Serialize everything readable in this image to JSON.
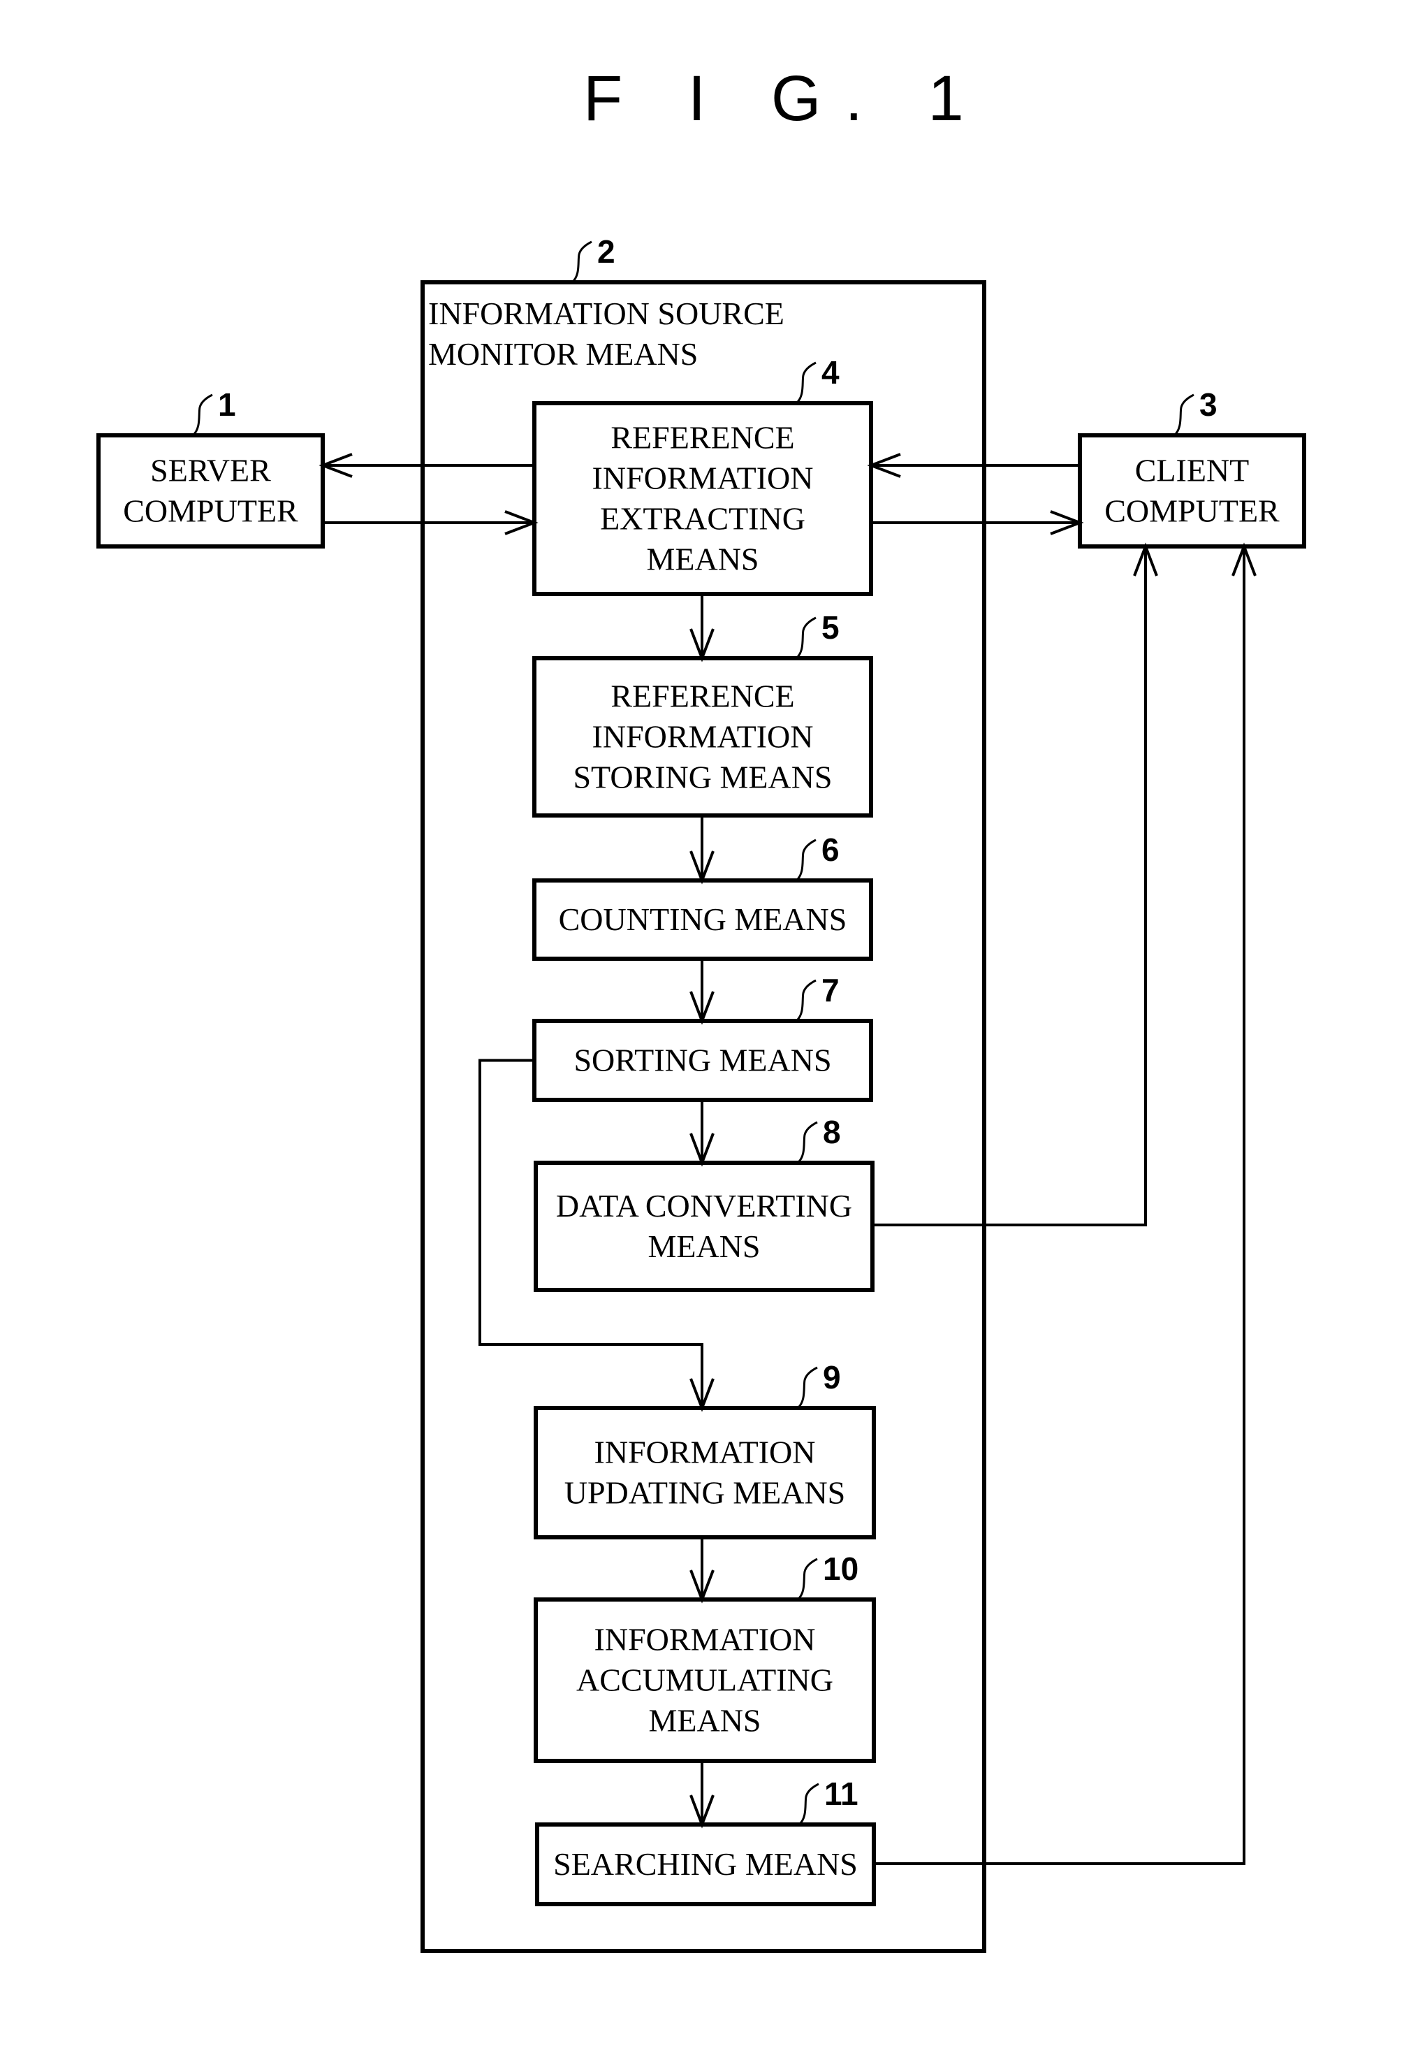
{
  "figure": {
    "title": "F I G. 1"
  },
  "nodes": [
    {
      "id": "server",
      "ref": "1",
      "lines": [
        "SERVER",
        "COMPUTER"
      ]
    },
    {
      "id": "monitor",
      "ref": "2",
      "lines": [
        "INFORMATION SOURCE",
        "MONITOR MEANS"
      ]
    },
    {
      "id": "client",
      "ref": "3",
      "lines": [
        "CLIENT",
        "COMPUTER"
      ]
    },
    {
      "id": "extracting",
      "ref": "4",
      "lines": [
        "REFERENCE",
        "INFORMATION",
        "EXTRACTING",
        "MEANS"
      ]
    },
    {
      "id": "storing",
      "ref": "5",
      "lines": [
        "REFERENCE",
        "INFORMATION",
        "STORING MEANS"
      ]
    },
    {
      "id": "counting",
      "ref": "6",
      "lines": [
        "COUNTING MEANS"
      ]
    },
    {
      "id": "sorting",
      "ref": "7",
      "lines": [
        "SORTING MEANS"
      ]
    },
    {
      "id": "converting",
      "ref": "8",
      "lines": [
        "DATA CONVERTING",
        "MEANS"
      ]
    },
    {
      "id": "updating",
      "ref": "9",
      "lines": [
        "INFORMATION",
        "UPDATING MEANS"
      ]
    },
    {
      "id": "accumulating",
      "ref": "10",
      "lines": [
        "INFORMATION",
        "ACCUMULATING",
        "MEANS"
      ]
    },
    {
      "id": "searching",
      "ref": "11",
      "lines": [
        "SEARCHING MEANS"
      ]
    }
  ],
  "edges": [
    {
      "from": "extracting",
      "to": "server"
    },
    {
      "from": "server",
      "to": "extracting"
    },
    {
      "from": "client",
      "to": "extracting"
    },
    {
      "from": "extracting",
      "to": "client"
    },
    {
      "from": "extracting",
      "to": "storing"
    },
    {
      "from": "storing",
      "to": "counting"
    },
    {
      "from": "counting",
      "to": "sorting"
    },
    {
      "from": "sorting",
      "to": "converting"
    },
    {
      "from": "sorting",
      "to": "updating"
    },
    {
      "from": "updating",
      "to": "accumulating"
    },
    {
      "from": "accumulating",
      "to": "searching"
    },
    {
      "from": "converting",
      "to": "client"
    },
    {
      "from": "searching",
      "to": "client"
    }
  ]
}
